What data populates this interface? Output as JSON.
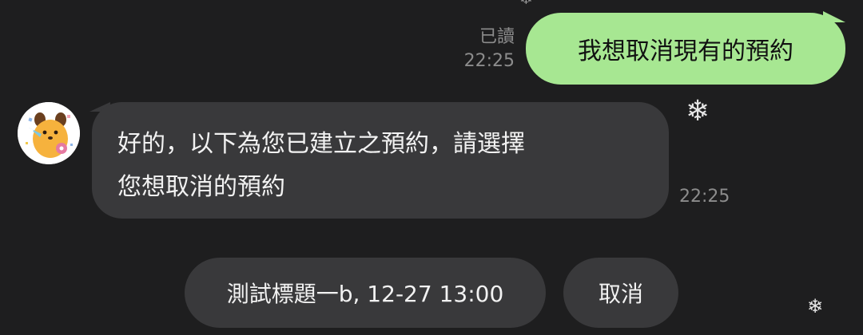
{
  "chat": {
    "outgoing": {
      "text": "我想取消現有的預約",
      "read_status": "已讀",
      "time": "22:25",
      "bubble_color": "#a7e792"
    },
    "incoming": {
      "lines": [
        "好的，以下為您已建立之預約，請選擇",
        "您想取消的預約"
      ],
      "time": "22:25",
      "bubble_color": "#39393b",
      "avatar_icon": "dog-character-avatar"
    }
  },
  "quick_replies": [
    {
      "label": "測試標題一b, 12-27 13:00"
    },
    {
      "label": "取消"
    }
  ],
  "decorations": {
    "snowflake_icon": "❄"
  }
}
